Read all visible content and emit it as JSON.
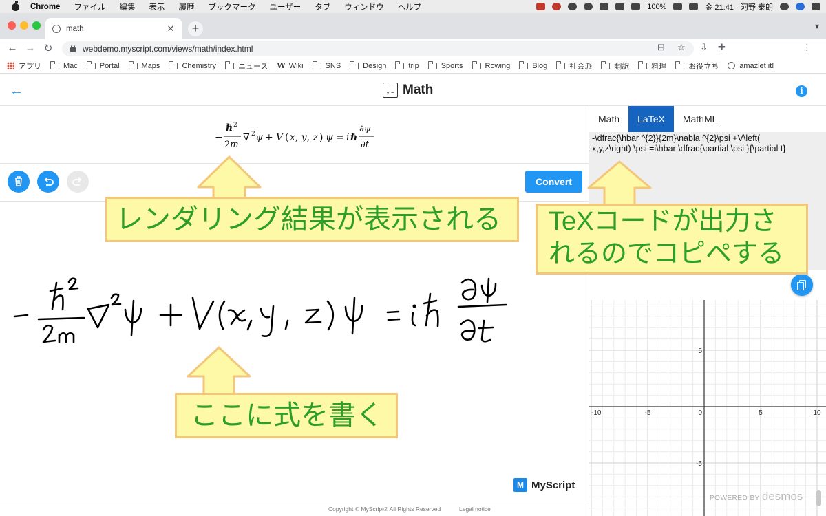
{
  "menubar": {
    "app": "Chrome",
    "items": [
      "ファイル",
      "編集",
      "表示",
      "履歴",
      "ブックマーク",
      "ユーザー",
      "タブ",
      "ウィンドウ",
      "ヘルプ"
    ],
    "battery": "100%",
    "datetime": "金 21:41",
    "user": "河野 泰朗"
  },
  "browser": {
    "tab_title": "math",
    "url": "webdemo.myscript.com/views/math/index.html"
  },
  "bookmarks": [
    "アプリ",
    "Mac",
    "Portal",
    "Maps",
    "Chemistry",
    "ニュース",
    "Wiki",
    "SNS",
    "Design",
    "trip",
    "Sports",
    "Rowing",
    "Blog",
    "社会派",
    "翻訳",
    "料理",
    "お役立ち",
    "amazlet it!"
  ],
  "app": {
    "title": "Math",
    "rendered_formula": "-\\dfrac{\\hbar ^{2}}{2m}\\nabla ^{2}\\psi +V\\left(x,y,z\\right) \\psi =i\\hbar \\dfrac{\\partial \\psi }{\\partial t}",
    "convert_label": "Convert",
    "tabs": [
      "Math",
      "LaTeX",
      "MathML"
    ],
    "active_tab": "LaTeX",
    "latex_output": "-\\dfrac{\\hbar ^{2}}{2m}\\nabla ^{2}\\psi +V\\left(\nx,y,z\\right) \\psi =i\\hbar \\dfrac{\\partial \\psi }{\\partial t}",
    "graph": {
      "x_ticks": [
        "-10",
        "-5",
        "0",
        "5",
        "10"
      ],
      "y_ticks": [
        "5",
        "-5"
      ]
    },
    "powered_by": "POWERED BY",
    "desmos": "desmos",
    "brand": "MyScript",
    "brand_mark": "M",
    "copyright": "Copyright © MyScript® All Rights Reserved",
    "legal": "Legal notice"
  },
  "callouts": {
    "render": "レンダリング結果が表示される",
    "tex": "TeXコードが出力さ\nれるのでコピペする",
    "write": "ここに式を書く"
  },
  "colors": {
    "accent": "#2196f3",
    "active_tab": "#1565c0",
    "callout_bg": "#fdf9a6",
    "callout_border": "#f4c67a",
    "callout_text": "#2e9e2a",
    "ink": "#000000"
  }
}
